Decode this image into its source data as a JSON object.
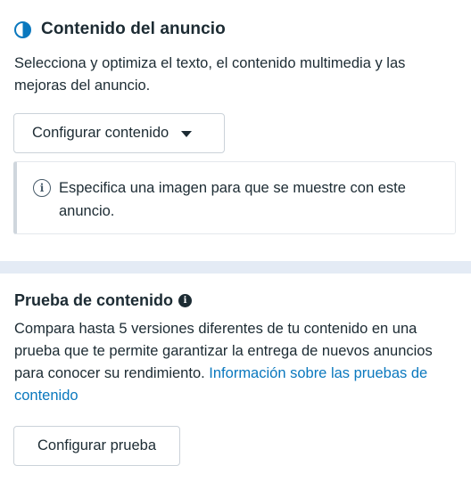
{
  "ad_content": {
    "title": "Contenido del anuncio",
    "icon": "half-circle-icon",
    "description": "Selecciona y optimiza el texto, el contenido multimedia y las mejoras del anuncio.",
    "configure_button": "Configurar contenido",
    "notice": {
      "icon": "info-icon",
      "text": "Especifica una imagen para que se muestre con este anuncio."
    }
  },
  "content_test": {
    "title": "Prueba de contenido",
    "info_icon": "info-filled-icon",
    "description": "Compara hasta 5 versiones diferentes de tu contenido en una prueba que te permite garantizar la entrega de nuevos anuncios para conocer su rendimiento. ",
    "link": "Información sobre las pruebas de contenido",
    "configure_button": "Configurar prueba"
  },
  "colors": {
    "accent": "#0a78be",
    "text": "#1c2b33",
    "band": "#e4ebf5",
    "border": "#cbd2d9"
  }
}
